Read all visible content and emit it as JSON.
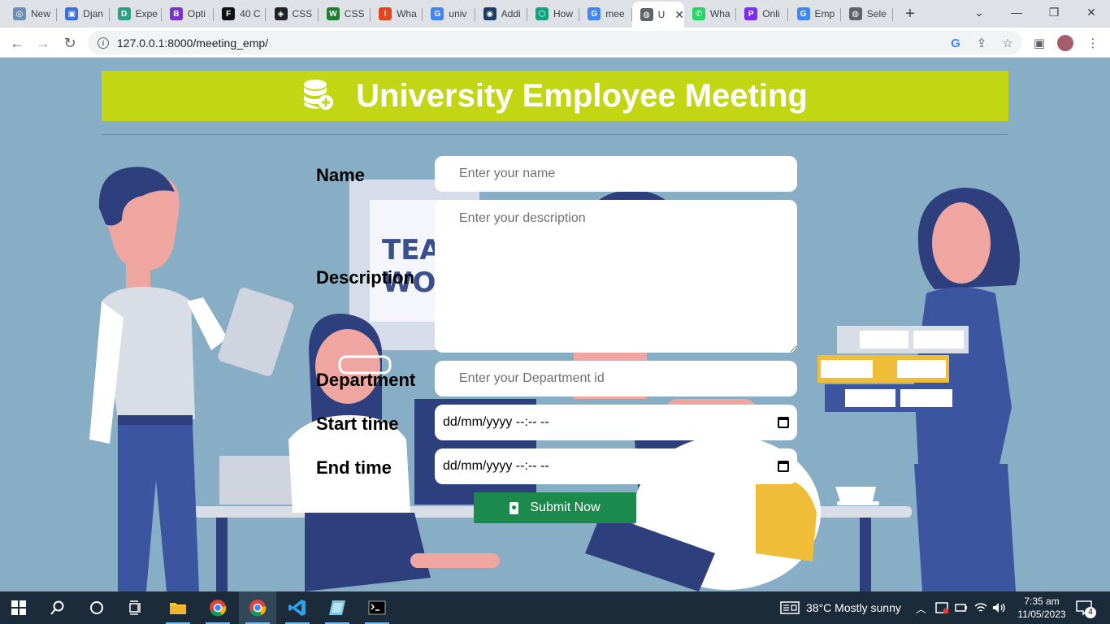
{
  "browser": {
    "tabs": [
      {
        "label": "New",
        "color": "#6a8fb1",
        "glyph": "◎"
      },
      {
        "label": "Djan",
        "color": "#3b6fd4",
        "glyph": "▣"
      },
      {
        "label": "Expe",
        "color": "#2f9e86",
        "glyph": "D"
      },
      {
        "label": "Opti",
        "color": "#7a32c9",
        "glyph": "B"
      },
      {
        "label": "40 C",
        "color": "#111111",
        "glyph": "F"
      },
      {
        "label": "CSS",
        "color": "#222222",
        "glyph": "◈"
      },
      {
        "label": "CSS",
        "color": "#1b7f2d",
        "glyph": "W"
      },
      {
        "label": "Wha",
        "color": "#e2461d",
        "glyph": "!"
      },
      {
        "label": "univ",
        "color": "#4285f4",
        "glyph": "G"
      },
      {
        "label": "Addi",
        "color": "#1d3b63",
        "glyph": "◉"
      },
      {
        "label": "How",
        "color": "#10a37f",
        "glyph": "⬡"
      },
      {
        "label": "mee",
        "color": "#4285f4",
        "glyph": "G"
      },
      {
        "label": "U",
        "color": "#5f6368",
        "glyph": "◍",
        "active": true
      },
      {
        "label": "Wha",
        "color": "#25d366",
        "glyph": "✆"
      },
      {
        "label": "Onli",
        "color": "#7b2cf5",
        "glyph": "P"
      },
      {
        "label": "Emp",
        "color": "#4285f4",
        "glyph": "G"
      },
      {
        "label": "Sele",
        "color": "#5f6368",
        "glyph": "◍"
      }
    ],
    "new_tab": "+",
    "url": "127.0.0.1:8000/meeting_emp/"
  },
  "page": {
    "title": "University Employee Meeting",
    "form": {
      "name_label": "Name",
      "name_placeholder": "Enter your name",
      "description_label": "Description",
      "description_placeholder": "Enter your description",
      "department_label": "Department",
      "department_placeholder": "Enter your Department id",
      "start_label": "Start time",
      "start_value": "dd/mm/yyyy --:-- --",
      "end_label": "End time",
      "end_value": "dd/mm/yyyy --:-- --",
      "submit_label": "Submit Now"
    },
    "poster_text_1": "TEAM",
    "poster_text_2": "WOR"
  },
  "taskbar": {
    "weather": "38°C  Mostly sunny",
    "time": "7:35 am",
    "date": "11/05/2023",
    "notifications": "4"
  },
  "colors": {
    "banner": "#c3d614",
    "submit": "#1b8a4c",
    "background": "#88aec6"
  }
}
